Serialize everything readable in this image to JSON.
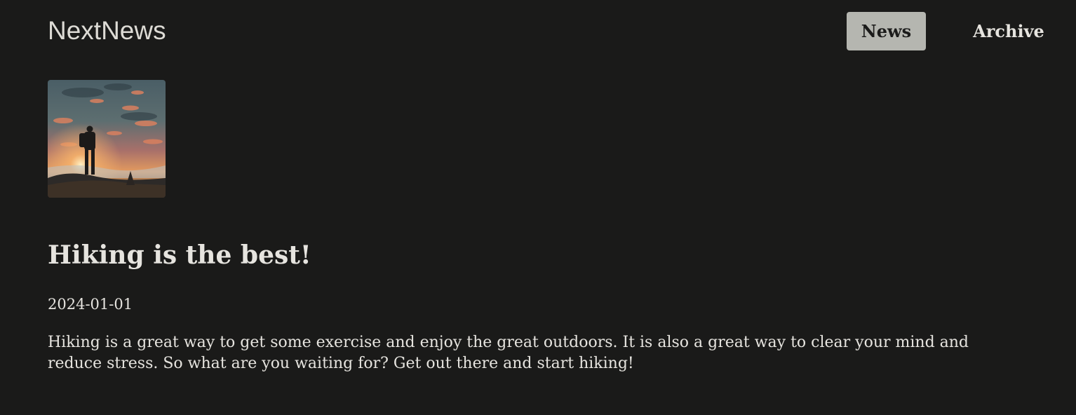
{
  "header": {
    "logo": "NextNews",
    "nav": {
      "news": "News",
      "archive": "Archive"
    },
    "active_nav": "News"
  },
  "article": {
    "image_alt": "hiker silhouette at sunset",
    "title": "Hiking is the best!",
    "date": "2024-01-01",
    "body": "Hiking is a great way to get some exercise and enjoy the great outdoors. It is also a great way to clear your mind and reduce stress. So what are you waiting for? Get out there and start hiking!"
  },
  "colors": {
    "background": "#1a1a19",
    "text": "#e6e4df",
    "active_nav_bg": "#b5b6b0",
    "active_nav_text": "#1b1b1a"
  }
}
